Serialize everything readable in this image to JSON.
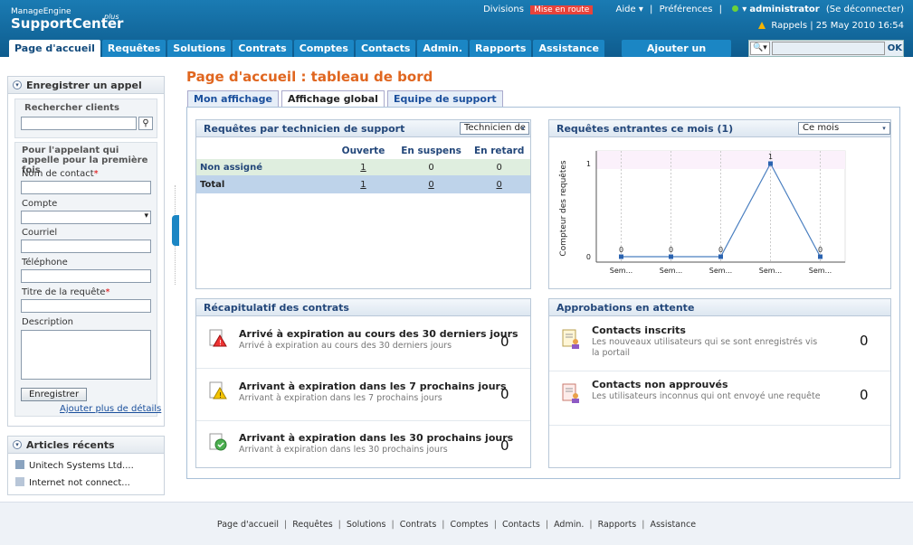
{
  "header": {
    "brand_top": "ManageEngine",
    "brand_main": "SupportCenter",
    "brand_plus": "plus",
    "divisions": "Divisions",
    "divisions_badge": "Mise en route",
    "aide": "Aide",
    "preferences": "Préférences",
    "user": "administrator",
    "logout": "(Se déconnecter)",
    "reminders": "Rappels",
    "datetime": "25 May 2010 16:54"
  },
  "nav": {
    "tabs": [
      "Page d'accueil",
      "Requêtes",
      "Solutions",
      "Contrats",
      "Comptes",
      "Contacts",
      "Admin.",
      "Rapports",
      "Assistance"
    ],
    "add_new": "Ajouter un nouveau",
    "search_ok": "OK"
  },
  "left": {
    "call_title": "Enregistrer un appel",
    "search_clients": "Rechercher clients",
    "first_time_caller": "Pour l'appelant qui appelle pour la première fois",
    "contact_name": "Nom de contact",
    "account": "Compte",
    "email": "Courriel",
    "phone": "Téléphone",
    "request_title": "Titre de la requête",
    "description": "Description",
    "register_button": "Enregistrer",
    "more_details": "Ajouter plus de détails",
    "recent_title": "Articles récents",
    "recent_items": [
      "Unitech Systems Ltd....",
      "Internet not connect..."
    ]
  },
  "main": {
    "page_title": "Page d'accueil : tableau de bord",
    "subtabs": [
      "Mon affichage",
      "Affichage global",
      "Equipe de support"
    ],
    "tech_card": {
      "title": "Requêtes par technicien de support",
      "select": "Technicien de",
      "headers": [
        "",
        "Ouverte",
        "En suspens",
        "En retard"
      ],
      "rows": [
        {
          "name": "Non assigné",
          "open": "1",
          "hold": "0",
          "overdue": "0"
        },
        {
          "name": "Total",
          "open": "1",
          "hold": "0",
          "overdue": "0"
        }
      ]
    },
    "incoming_card": {
      "title": "Requêtes entrantes ce mois (1)",
      "select": "Ce mois"
    },
    "contracts_card": {
      "title": "Récapitulatif des contrats",
      "items": [
        {
          "title": "Arrivé à expiration au cours des 30 derniers jours",
          "sub": "Arrivé à expiration au cours des 30 derniers jours",
          "value": "0"
        },
        {
          "title": "Arrivant à expiration dans les 7 prochains jours",
          "sub": "Arrivant à expiration dans les 7 prochains jours",
          "value": "0"
        },
        {
          "title": "Arrivant à expiration dans les 30 prochains jours",
          "sub": "Arrivant à expiration dans les 30 prochains jours",
          "value": "0"
        }
      ]
    },
    "approvals_card": {
      "title": "Approbations en attente",
      "items": [
        {
          "title": "Contacts inscrits",
          "sub": "Les nouveaux utilisateurs qui se sont enregistrés vis la portail",
          "value": "0"
        },
        {
          "title": "Contacts non approuvés",
          "sub": "Les utilisateurs inconnus qui ont envoyé une requête",
          "value": "0"
        }
      ]
    }
  },
  "chart_data": {
    "type": "line",
    "categories": [
      "Sem...",
      "Sem...",
      "Sem...",
      "Sem...",
      "Sem..."
    ],
    "values": [
      0,
      0,
      0,
      1,
      0
    ],
    "ylabel": "Compteur des requêtes",
    "ylim": [
      0,
      1
    ],
    "yticks": [
      "0",
      "1"
    ],
    "grid": true,
    "color": "#4a7fc0"
  },
  "footer": {
    "links": [
      "Page d'accueil",
      "Requêtes",
      "Solutions",
      "Contrats",
      "Comptes",
      "Contacts",
      "Admin.",
      "Rapports",
      "Assistance"
    ]
  }
}
